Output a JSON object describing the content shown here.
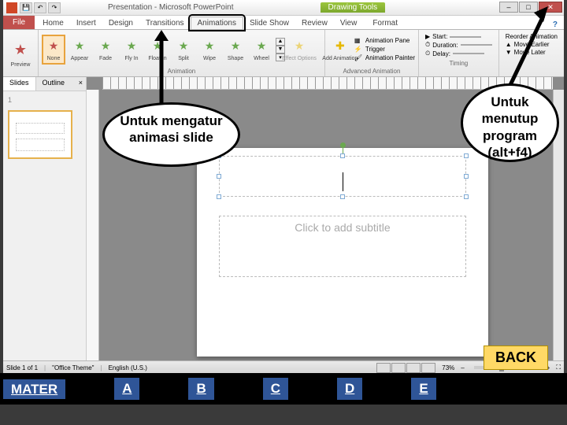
{
  "titlebar": {
    "doc_name": "Presentation",
    "app_name": "Microsoft PowerPoint",
    "context_tab": "Drawing Tools"
  },
  "tabs": {
    "file": "File",
    "home": "Home",
    "insert": "Insert",
    "design": "Design",
    "transitions": "Transitions",
    "animations": "Animations",
    "slideshow": "Slide Show",
    "review": "Review",
    "view": "View",
    "format": "Format"
  },
  "ribbon": {
    "preview": {
      "label": "Preview"
    },
    "none": {
      "label": "None"
    },
    "appear": {
      "label": "Appear"
    },
    "fade": {
      "label": "Fade"
    },
    "flyin": {
      "label": "Fly In"
    },
    "floatin": {
      "label": "Float In"
    },
    "split": {
      "label": "Split"
    },
    "wipe": {
      "label": "Wipe"
    },
    "shape": {
      "label": "Shape"
    },
    "wheel": {
      "label": "Wheel"
    },
    "group_anim": "Animation",
    "effect_options": {
      "label": "Effect Options"
    },
    "add_anim": {
      "label": "Add Animation"
    },
    "anim_pane": "Animation Pane",
    "trigger": "Trigger",
    "anim_painter": "Animation Painter",
    "group_adv": "Advanced Animation",
    "start_lbl": "Start:",
    "duration_lbl": "Duration:",
    "delay_lbl": "Delay:",
    "group_timing": "Timing",
    "reorder": "Reorder Animation",
    "move_earlier": "Move Earlier",
    "move_later": "Move Later"
  },
  "pane": {
    "slides": "Slides",
    "outline": "Outline",
    "thumb_num": "1"
  },
  "canvas": {
    "subtitle_placeholder": "Click to add subtitle"
  },
  "callouts": {
    "animations": "Untuk mengatur animasi slide",
    "close": "Untuk menutup program (alt+f4)"
  },
  "status": {
    "slide": "Slide 1 of 1",
    "theme": "\"Office Theme\"",
    "lang": "English (U.S.)",
    "zoom": "73%"
  },
  "nav": {
    "mater": "MATER",
    "a": "A",
    "b": "B",
    "c": "C",
    "d": "D",
    "e": "E"
  },
  "back": "BACK"
}
